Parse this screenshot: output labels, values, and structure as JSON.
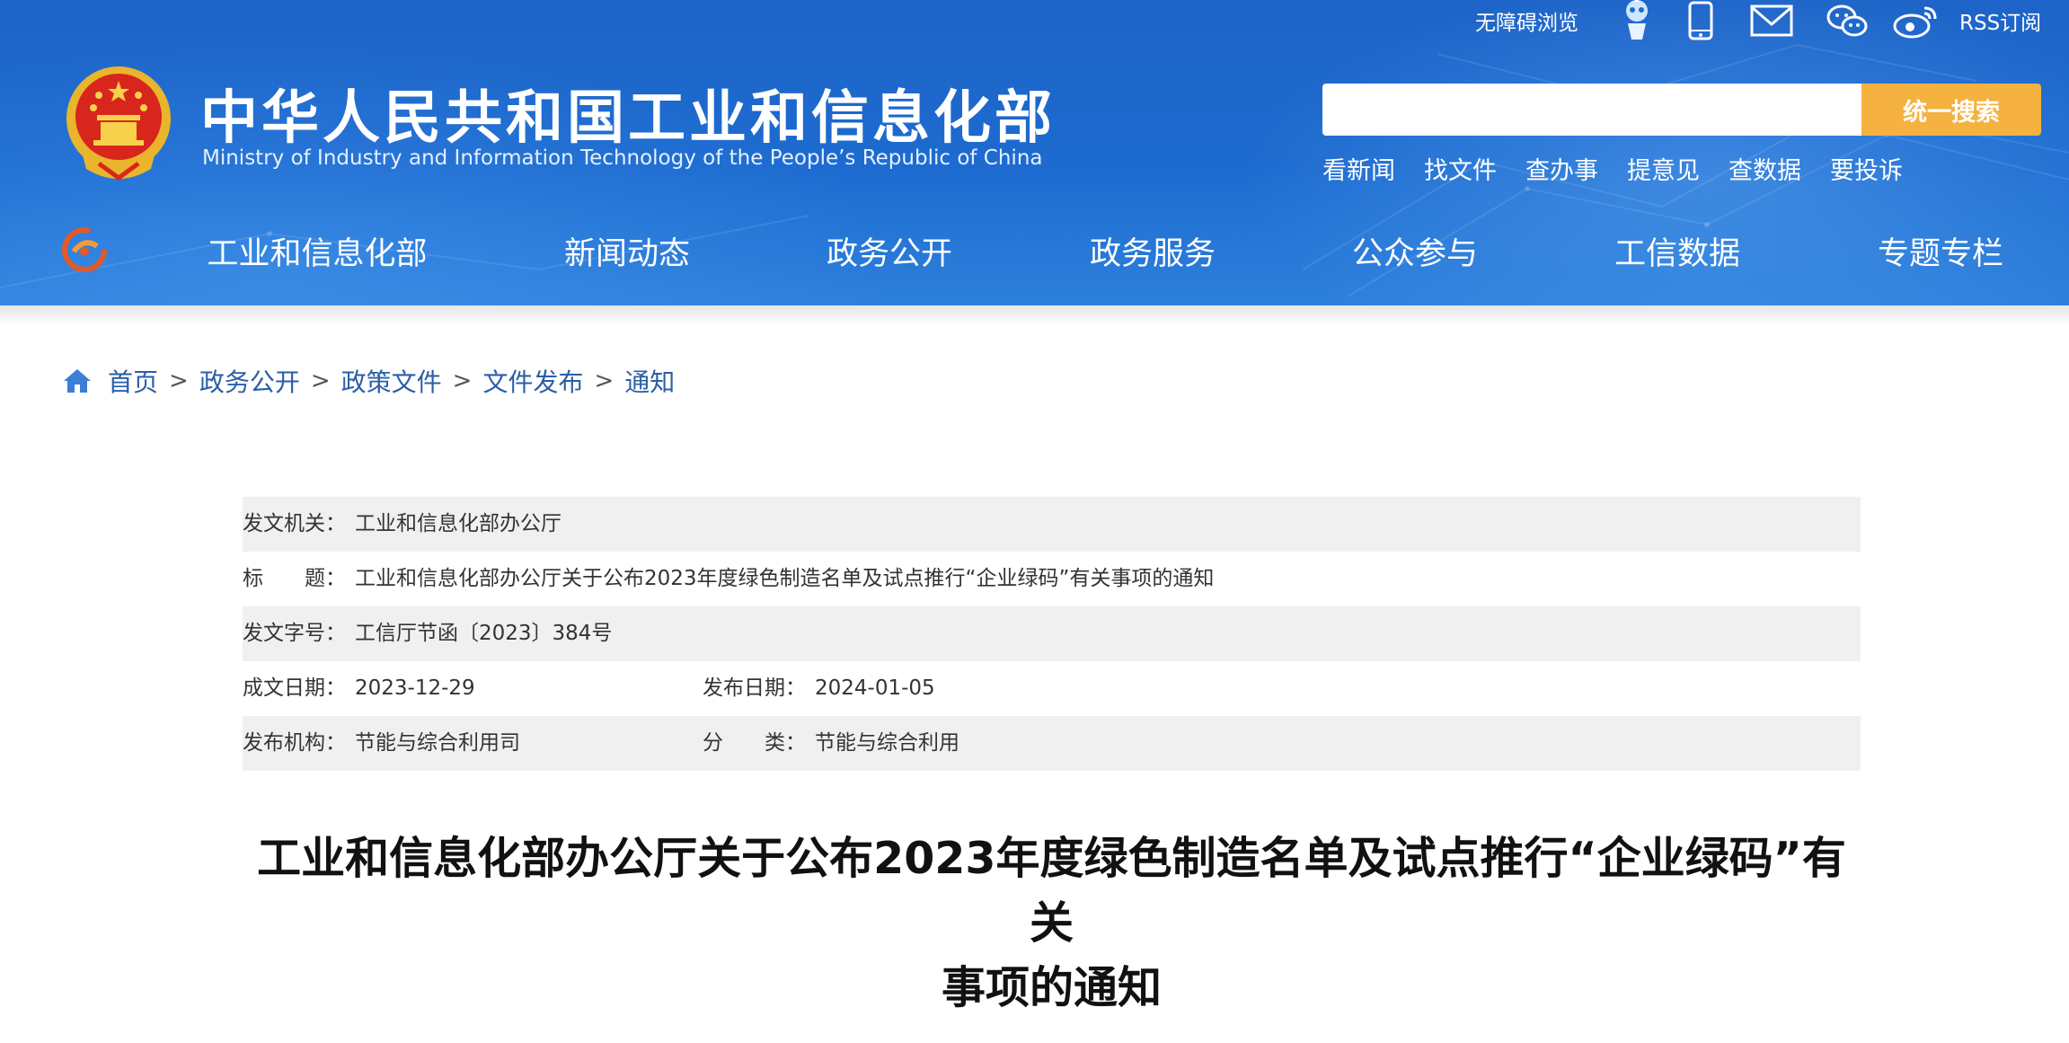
{
  "header": {
    "title_cn": "中华人民共和国工业和信息化部",
    "title_en": "Ministry of Industry and Information Technology of the People’s Republic of China",
    "topbar": {
      "accessibility": "无障碍浏览",
      "rss": "RSS订阅",
      "icons": [
        "robot-assistant-icon",
        "mobile-icon",
        "mail-icon",
        "wechat-icon",
        "weibo-icon"
      ]
    },
    "search": {
      "placeholder": "",
      "button": "统一搜索"
    },
    "quick_links": [
      "看新闻",
      "找文件",
      "查办事",
      "提意见",
      "查数据",
      "要投诉"
    ]
  },
  "nav": {
    "items": [
      "工业和信息化部",
      "新闻动态",
      "政务公开",
      "政务服务",
      "公众参与",
      "工信数据",
      "专题专栏"
    ]
  },
  "breadcrumb": {
    "items": [
      "首页",
      "政务公开",
      "政策文件",
      "文件发布",
      "通知"
    ],
    "separator": ">"
  },
  "meta": {
    "issuer_label": "发文机关：",
    "issuer": "工业和信息化部办公厅",
    "title_label": "标　　题：",
    "title": "工业和信息化部办公厅关于公布2023年度绿色制造名单及试点推行“企业绿码”有关事项的通知",
    "doc_no_label": "发文字号：",
    "doc_no": "工信厅节函〔2023〕384号",
    "written_label": "成文日期：",
    "written": "2023-12-29",
    "published_label": "发布日期：",
    "published": "2024-01-05",
    "org_label": "发布机构：",
    "org": "节能与综合利用司",
    "category_label": "分　　类：",
    "category": "节能与综合利用"
  },
  "article": {
    "title_line1": "工业和信息化部办公厅关于公布2023年度绿色制造名单及试点推行“企业绿码”有关",
    "title_line2": "事项的通知"
  },
  "colors": {
    "header_blue": "#1d6bd0",
    "search_button": "#f5b240",
    "link_blue": "#2a5ea7",
    "row_shade": "#f0f0f0"
  }
}
